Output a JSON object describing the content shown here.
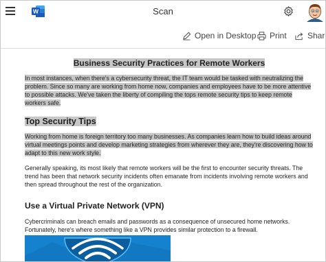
{
  "app": {
    "title": "Scan",
    "logo_letter": "W"
  },
  "toolbar": {
    "open_desktop_label": "Open in Desktop",
    "print_label": "Print",
    "share_label": "Share"
  },
  "document": {
    "title": "Business Security Practices for Remote Workers",
    "intro": "In most instances, when there's a cybersecurity threat, the IT team would be tasked with neutralizing the problem. Since so many are working from home now, companies and employees have to be more attentive to possible attacks. We've taken the liberty of compiling the tops remote security tips to keep remote workers safe.",
    "section1_heading": "Top Security Tips",
    "section1_para1": "Working from home is foreign territory too many businesses. As companies learn how to build ideas around virtual meetings points and develop marketing strategies from wherever they are, they're discovering how to adapt to this new work style.",
    "section1_para2": "Generally speaking, its most likely that remote workers will be the first to encounter security threats. The trend has been that network security incidents often emanate from incidents involving remote workers and then spread throughout the rest of the organization.",
    "section2_heading": "Use a Virtual Private Network (VPN)",
    "section2_para1": "Cybercriminals can breach emails and passwords as a consequence of unsecured home networks. Fortunately, here's where something like a VPN provides similar protection to a firewall."
  },
  "colors": {
    "highlight": "#c7c7c7",
    "word_blue": "#185abd",
    "image_blue": "#1d8fd8"
  }
}
